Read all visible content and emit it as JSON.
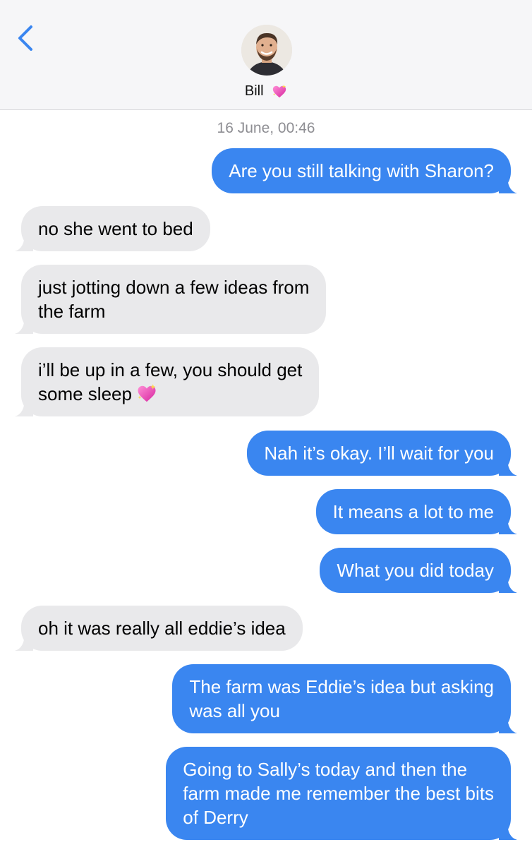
{
  "header": {
    "contact_name": "Bill",
    "avatar_label": "Bill avatar",
    "contact_emoji": "sparkling-heart-icon"
  },
  "timestamp": "16 June, 00:46",
  "colors": {
    "outgoing_bubble": "#3a86f0",
    "incoming_bubble": "#e9e9eb",
    "accent": "#3a86f0",
    "header_bg": "#f6f6f8"
  },
  "messages": [
    {
      "direction": "out",
      "text": "Are you still talking with Sharon?"
    },
    {
      "direction": "in",
      "text": "no she went to bed"
    },
    {
      "direction": "in",
      "lines": [
        "just jotting down a few ideas from",
        "the farm"
      ]
    },
    {
      "direction": "in",
      "lines": [
        "i’ll be up in a few, you should get",
        "some sleep"
      ],
      "emoji": "sparkling-heart-icon"
    },
    {
      "direction": "out",
      "text": "Nah it’s okay. I’ll wait for you"
    },
    {
      "direction": "out",
      "text": "It means a lot to me"
    },
    {
      "direction": "out",
      "text": "What you did today"
    },
    {
      "direction": "in",
      "text": "oh it was really all eddie’s idea"
    },
    {
      "direction": "out",
      "lines": [
        "The farm was Eddie’s idea but asking",
        "was all you"
      ]
    },
    {
      "direction": "out",
      "lines": [
        "Going to Sally’s today and then the",
        "farm made me remember the best bits",
        "of Derry"
      ]
    }
  ]
}
